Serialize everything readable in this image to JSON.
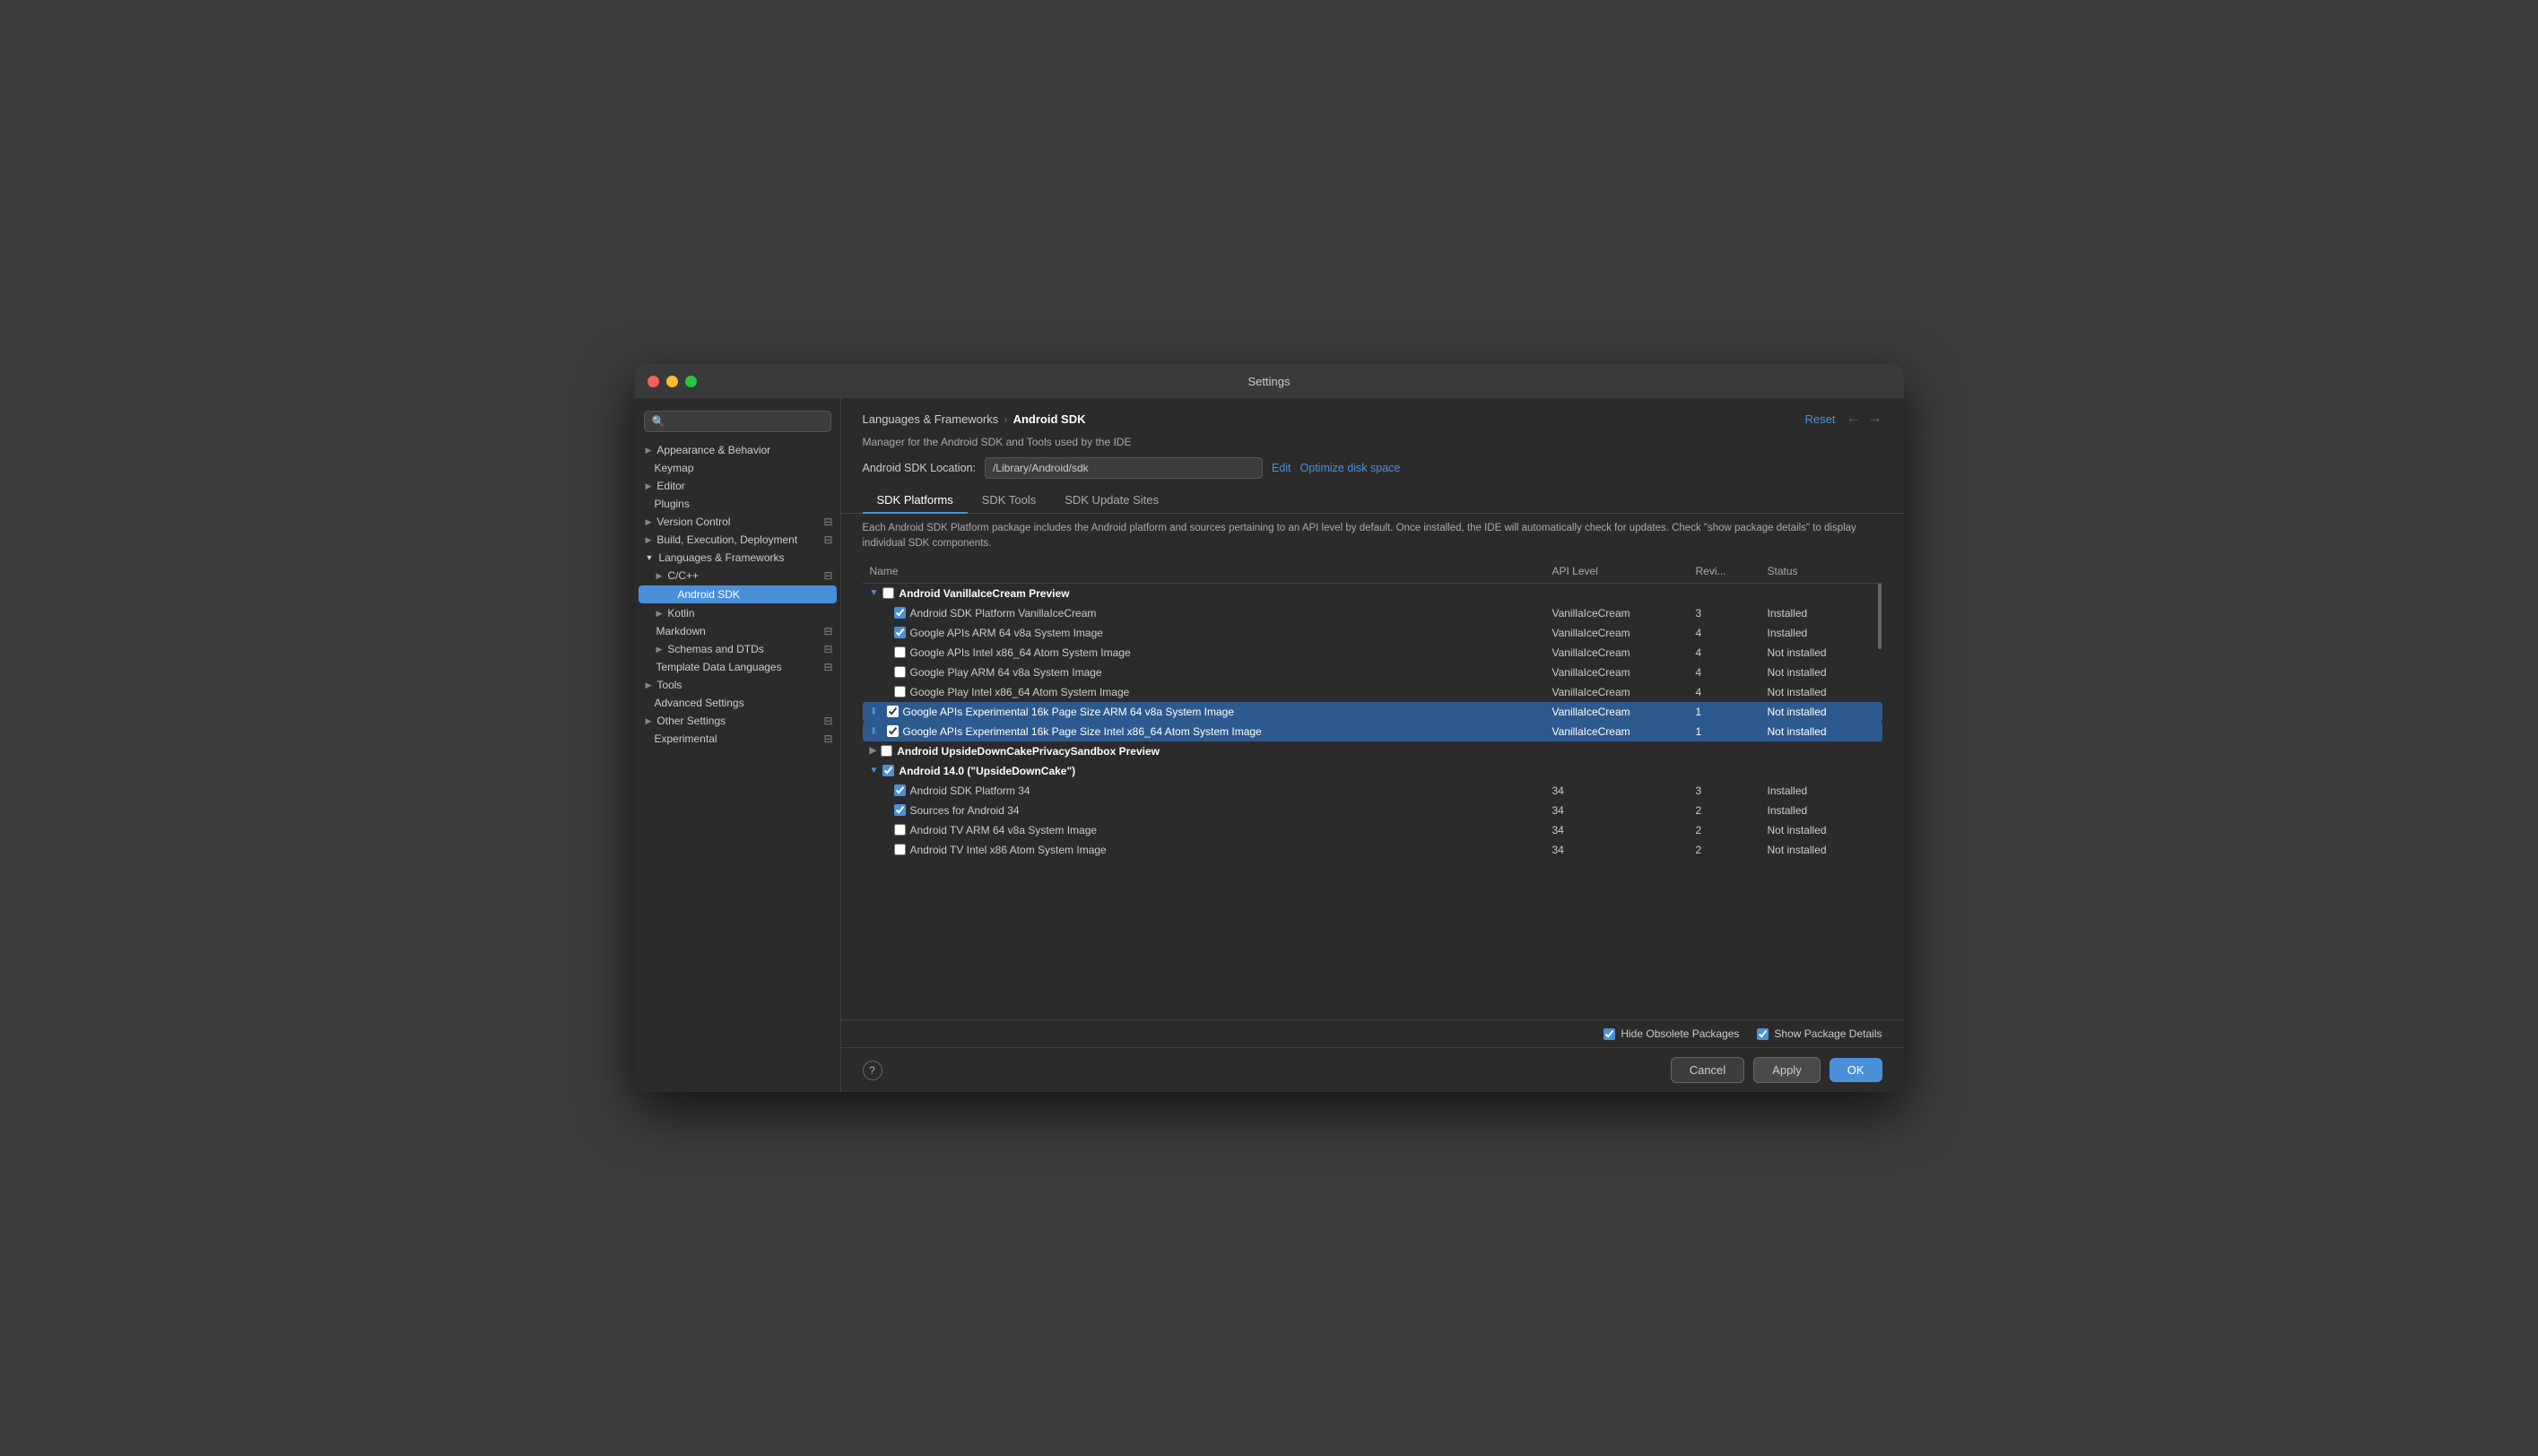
{
  "window": {
    "title": "Settings"
  },
  "sidebar": {
    "search_placeholder": "🔍",
    "items": [
      {
        "id": "appearance",
        "label": "Appearance & Behavior",
        "indent": 0,
        "expandable": true,
        "expanded": false
      },
      {
        "id": "keymap",
        "label": "Keymap",
        "indent": 0,
        "expandable": false
      },
      {
        "id": "editor",
        "label": "Editor",
        "indent": 0,
        "expandable": true,
        "expanded": false
      },
      {
        "id": "plugins",
        "label": "Plugins",
        "indent": 0,
        "expandable": false
      },
      {
        "id": "version-control",
        "label": "Version Control",
        "indent": 0,
        "expandable": true,
        "expanded": false,
        "badge": true
      },
      {
        "id": "build",
        "label": "Build, Execution, Deployment",
        "indent": 0,
        "expandable": true,
        "expanded": false,
        "badge": true
      },
      {
        "id": "languages",
        "label": "Languages & Frameworks",
        "indent": 0,
        "expandable": true,
        "expanded": true
      },
      {
        "id": "cpp",
        "label": "C/C++",
        "indent": 1,
        "expandable": true,
        "expanded": false,
        "badge": true
      },
      {
        "id": "android-sdk",
        "label": "Android SDK",
        "indent": 2,
        "expandable": false,
        "active": true
      },
      {
        "id": "kotlin",
        "label": "Kotlin",
        "indent": 1,
        "expandable": true,
        "expanded": false
      },
      {
        "id": "markdown",
        "label": "Markdown",
        "indent": 1,
        "expandable": false,
        "badge": true
      },
      {
        "id": "schemas",
        "label": "Schemas and DTDs",
        "indent": 1,
        "expandable": true,
        "expanded": false,
        "badge": true
      },
      {
        "id": "template-data",
        "label": "Template Data Languages",
        "indent": 1,
        "expandable": false,
        "badge": true
      },
      {
        "id": "tools",
        "label": "Tools",
        "indent": 0,
        "expandable": true,
        "expanded": false
      },
      {
        "id": "advanced",
        "label": "Advanced Settings",
        "indent": 0,
        "expandable": false
      },
      {
        "id": "other-settings",
        "label": "Other Settings",
        "indent": 0,
        "expandable": true,
        "expanded": false,
        "badge": true
      },
      {
        "id": "experimental",
        "label": "Experimental",
        "indent": 0,
        "expandable": false,
        "badge": true
      }
    ]
  },
  "main": {
    "breadcrumb": {
      "parent": "Languages & Frameworks",
      "separator": "›",
      "current": "Android SDK"
    },
    "reset_label": "Reset",
    "description": "Manager for the Android SDK and Tools used by the IDE",
    "sdk_location_label": "Android SDK Location:",
    "sdk_location_value": "/Library/Android/sdk",
    "edit_label": "Edit",
    "optimize_label": "Optimize disk space",
    "tabs": [
      {
        "id": "platforms",
        "label": "SDK Platforms",
        "active": true
      },
      {
        "id": "tools",
        "label": "SDK Tools",
        "active": false
      },
      {
        "id": "update-sites",
        "label": "SDK Update Sites",
        "active": false
      }
    ],
    "table_description": "Each Android SDK Platform package includes the Android platform and sources pertaining to an API level by default. Once installed, the IDE will automatically check for updates. Check \"show package details\" to display individual SDK components.",
    "columns": [
      {
        "id": "name",
        "label": "Name"
      },
      {
        "id": "api",
        "label": "API Level"
      },
      {
        "id": "revision",
        "label": "Revi..."
      },
      {
        "id": "status",
        "label": "Status"
      }
    ],
    "rows": [
      {
        "type": "group-header",
        "indent": 0,
        "expanded": true,
        "checkbox": "mixed",
        "name": "Android VanillaIceCream Preview",
        "api": "",
        "revision": "",
        "status": ""
      },
      {
        "type": "item",
        "indent": 1,
        "checkbox": true,
        "name": "Android SDK Platform VanillaIceCream",
        "api": "VanillaIceCream",
        "revision": "3",
        "status": "Installed"
      },
      {
        "type": "item",
        "indent": 1,
        "checkbox": true,
        "name": "Google APIs ARM 64 v8a System Image",
        "api": "VanillaIceCream",
        "revision": "4",
        "status": "Installed"
      },
      {
        "type": "item",
        "indent": 1,
        "checkbox": false,
        "name": "Google APIs Intel x86_64 Atom System Image",
        "api": "VanillaIceCream",
        "revision": "4",
        "status": "Not installed"
      },
      {
        "type": "item",
        "indent": 1,
        "checkbox": false,
        "name": "Google Play ARM 64 v8a System Image",
        "api": "VanillaIceCream",
        "revision": "4",
        "status": "Not installed"
      },
      {
        "type": "item",
        "indent": 1,
        "checkbox": false,
        "name": "Google Play Intel x86_64 Atom System Image",
        "api": "VanillaIceCream",
        "revision": "4",
        "status": "Not installed"
      },
      {
        "type": "item",
        "indent": 1,
        "checkbox": true,
        "download": true,
        "selected": true,
        "name": "Google APIs Experimental 16k Page Size ARM 64 v8a System Image",
        "api": "VanillaIceCream",
        "revision": "1",
        "status": "Not installed"
      },
      {
        "type": "item",
        "indent": 1,
        "checkbox": true,
        "download": true,
        "selected": true,
        "name": "Google APIs Experimental 16k Page Size Intel x86_64 Atom System Image",
        "api": "VanillaIceCream",
        "revision": "1",
        "status": "Not installed"
      },
      {
        "type": "group-header",
        "indent": 0,
        "expanded": false,
        "checkbox": false,
        "name": "Android UpsideDownCakePrivacySandbox Preview",
        "api": "",
        "revision": "",
        "status": ""
      },
      {
        "type": "group-header",
        "indent": 0,
        "expanded": true,
        "checkbox": "mixed",
        "name": "Android 14.0 (\"UpsideDownCake\")",
        "api": "",
        "revision": "",
        "status": ""
      },
      {
        "type": "item",
        "indent": 1,
        "checkbox": true,
        "name": "Android SDK Platform 34",
        "api": "34",
        "revision": "3",
        "status": "Installed"
      },
      {
        "type": "item",
        "indent": 1,
        "checkbox": true,
        "name": "Sources for Android 34",
        "api": "34",
        "revision": "2",
        "status": "Installed"
      },
      {
        "type": "item",
        "indent": 1,
        "checkbox": false,
        "name": "Android TV ARM 64 v8a System Image",
        "api": "34",
        "revision": "2",
        "status": "Not installed"
      },
      {
        "type": "item",
        "indent": 1,
        "checkbox": false,
        "name": "Android TV Intel x86 Atom System Image",
        "api": "34",
        "revision": "2",
        "status": "Not installed"
      }
    ],
    "bottom_options": {
      "hide_obsolete": true,
      "hide_obsolete_label": "Hide Obsolete Packages",
      "show_package": true,
      "show_package_label": "Show Package Details"
    },
    "footer": {
      "cancel_label": "Cancel",
      "apply_label": "Apply",
      "ok_label": "OK"
    }
  }
}
